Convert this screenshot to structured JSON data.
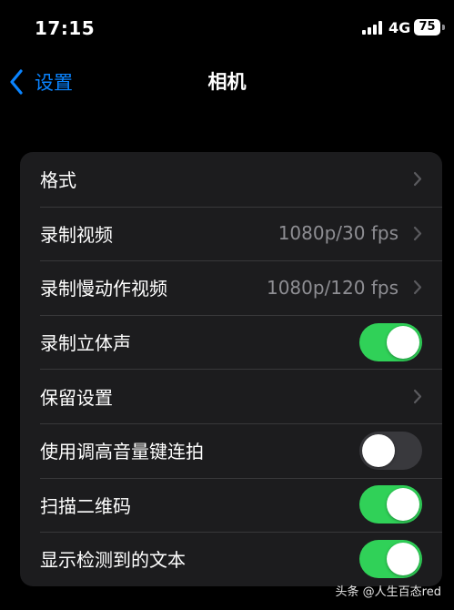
{
  "status_bar": {
    "time": "17:15",
    "network": "4G",
    "battery": "75"
  },
  "nav": {
    "back_label": "设置",
    "title": "相机"
  },
  "rows": [
    {
      "label": "格式",
      "value": "",
      "control": "chevron"
    },
    {
      "label": "录制视频",
      "value": "1080p/30 fps",
      "control": "chevron"
    },
    {
      "label": "录制慢动作视频",
      "value": "1080p/120 fps",
      "control": "chevron"
    },
    {
      "label": "录制立体声",
      "control": "toggle",
      "on": true
    },
    {
      "label": "保留设置",
      "value": "",
      "control": "chevron"
    },
    {
      "label": "使用调高音量键连拍",
      "control": "toggle",
      "on": false
    },
    {
      "label": "扫描二维码",
      "control": "toggle",
      "on": true
    },
    {
      "label": "显示检测到的文本",
      "control": "toggle",
      "on": true
    }
  ],
  "watermark": "头条 @人生百态red",
  "colors": {
    "accent": "#0a84ff",
    "toggle_on": "#30d158",
    "toggle_off": "#39393d",
    "group_bg": "#1c1c1e"
  }
}
